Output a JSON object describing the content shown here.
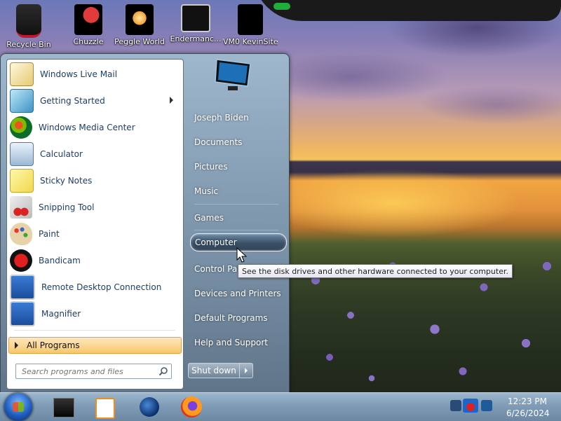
{
  "desktop": {
    "icons": [
      {
        "label": "Recycle Bin"
      },
      {
        "label": "Chuzzle"
      },
      {
        "label": "Peggle World"
      },
      {
        "label": "Endermanc..."
      },
      {
        "label": "VM0 KevinSite"
      }
    ]
  },
  "start_menu": {
    "programs": [
      {
        "label": "Windows Live Mail",
        "icon": "mail-icon"
      },
      {
        "label": "Getting Started",
        "icon": "getting-started-icon",
        "has_submenu": true
      },
      {
        "label": "Windows Media Center",
        "icon": "media-center-icon"
      },
      {
        "label": "Calculator",
        "icon": "calculator-icon"
      },
      {
        "label": "Sticky Notes",
        "icon": "sticky-notes-icon"
      },
      {
        "label": "Snipping Tool",
        "icon": "scissors-icon"
      },
      {
        "label": "Paint",
        "icon": "paint-palette-icon"
      },
      {
        "label": "Bandicam",
        "icon": "record-icon"
      },
      {
        "label": "Remote Desktop Connection",
        "icon": "remote-desktop-icon"
      },
      {
        "label": "Magnifier",
        "icon": "magnifier-icon"
      }
    ],
    "all_programs": "All Programs",
    "search_placeholder": "Search programs and files",
    "right_items": [
      {
        "label": "Joseph Biden"
      },
      {
        "label": "Documents"
      },
      {
        "label": "Pictures"
      },
      {
        "label": "Music"
      },
      {
        "label": "Games"
      },
      {
        "label": "Computer",
        "selected": true
      },
      {
        "label": "Control Panel"
      },
      {
        "label": "Devices and Printers"
      },
      {
        "label": "Default Programs"
      },
      {
        "label": "Help and Support"
      }
    ],
    "shutdown_label": "Shut down"
  },
  "tooltip": {
    "text": "See the disk drives and other hardware connected to your computer."
  },
  "taskbar": {
    "pinned": [
      "terminal-icon",
      "media-player-icon",
      "globe-icon",
      "firefox-icon"
    ],
    "clock": {
      "time": "12:23 PM",
      "date": "6/26/2024"
    }
  }
}
